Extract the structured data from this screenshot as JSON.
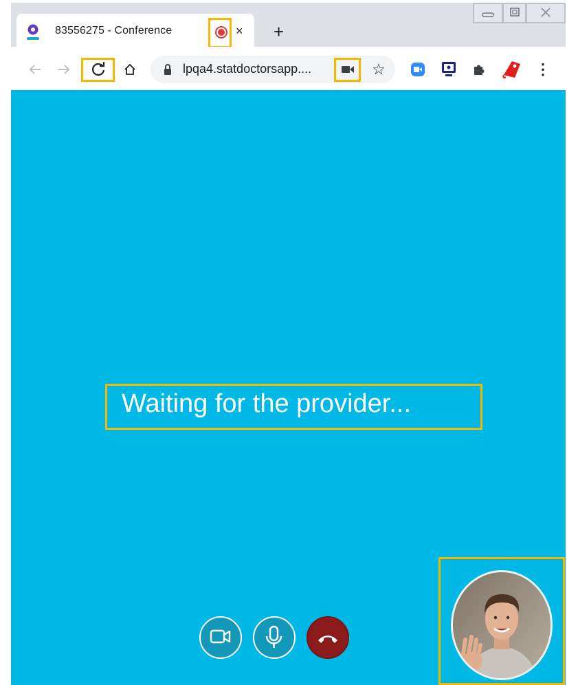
{
  "tab": {
    "title": "83556275 - Conference",
    "close_glyph": "×",
    "new_tab_glyph": "+"
  },
  "toolbar": {
    "url": "lpqa4.statdoctorsapp....",
    "star_glyph": "☆",
    "menu_glyph": "⋮"
  },
  "content": {
    "status_text": "Waiting for the provider..."
  },
  "controls": [
    "camera-toggle",
    "microphone-toggle",
    "end-call"
  ],
  "icons": {
    "favicon": "conference-favicon",
    "recording": "recording-dot-icon",
    "back": "back-arrow-icon",
    "forward": "forward-arrow-icon",
    "reload": "reload-icon",
    "home": "home-icon",
    "lock": "lock-icon",
    "camera_in_use": "camera-in-use-icon",
    "extensions": [
      "zoom-extension-icon",
      "screen-share-extension-icon",
      "puzzle-extensions-icon",
      "red-tag-extension-icon"
    ]
  },
  "colors": {
    "video_background": "#00b8e6",
    "highlight": "#f5b800",
    "end_call": "#8b1a1a",
    "tabstrip": "#dee1e6"
  }
}
